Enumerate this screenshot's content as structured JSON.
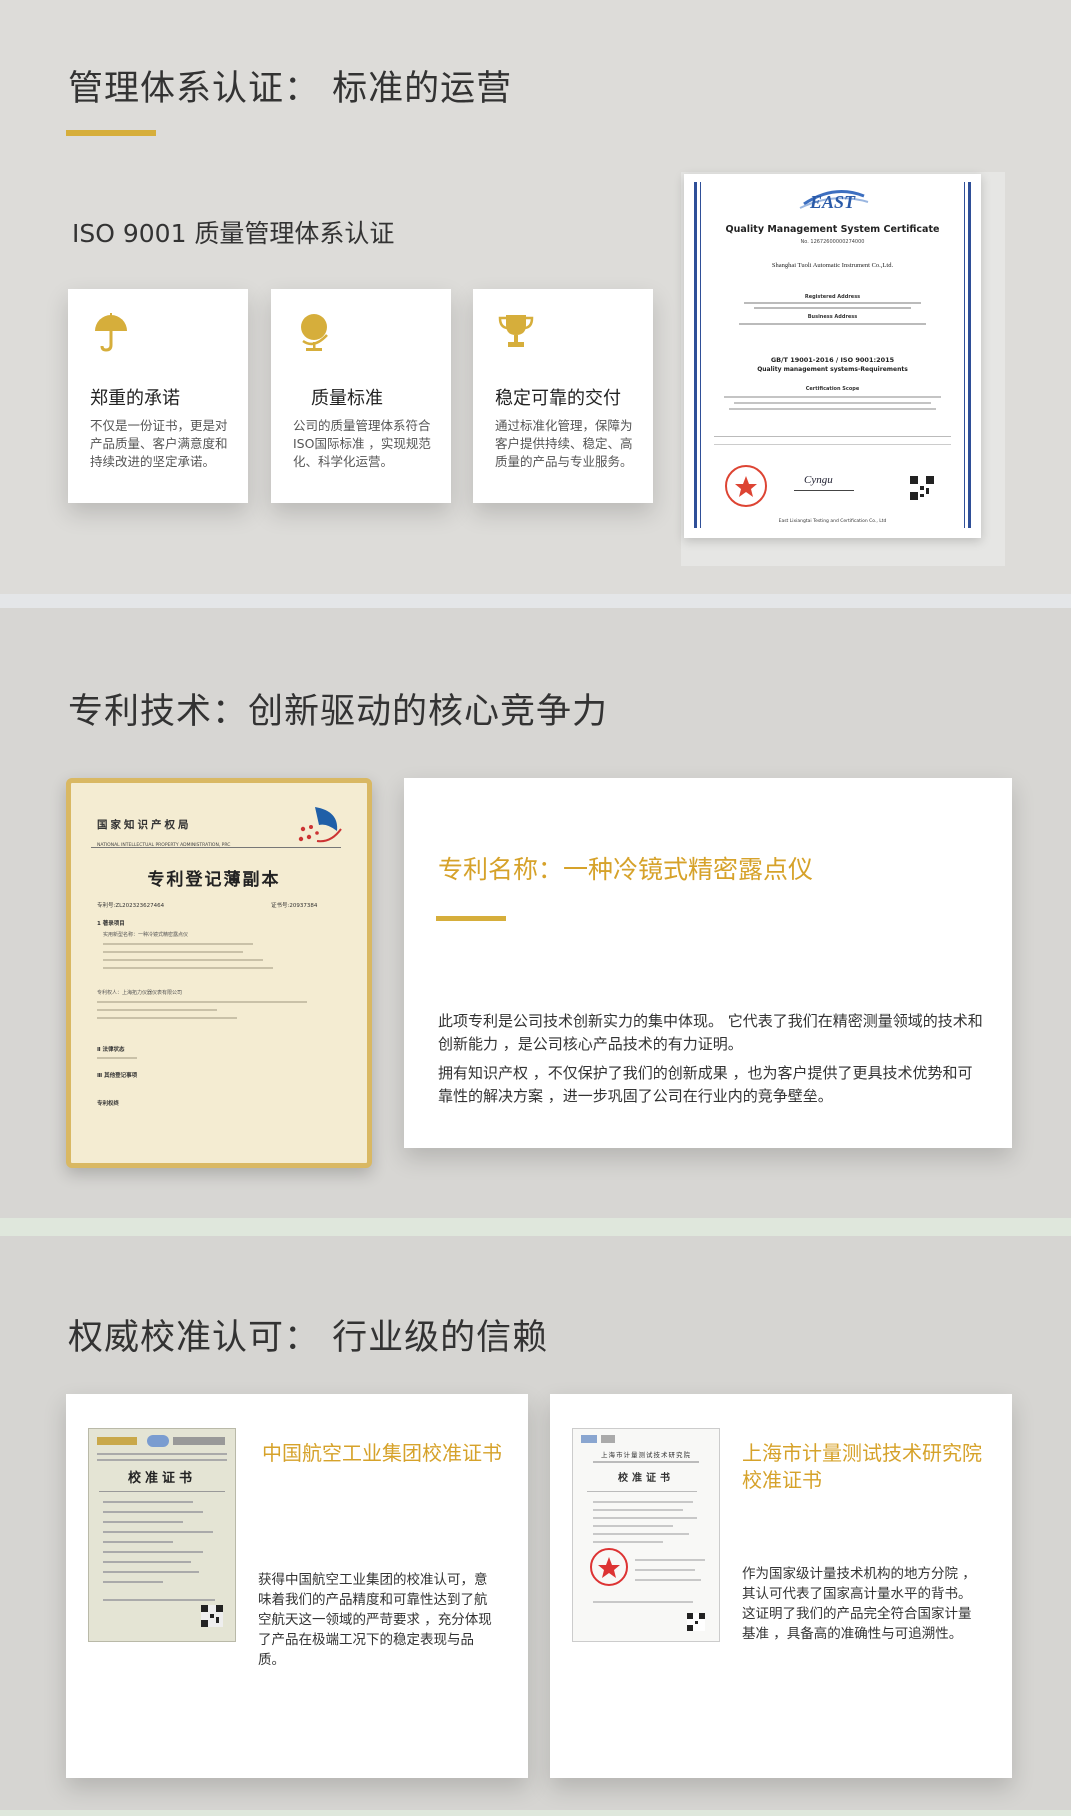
{
  "section1": {
    "title": "管理体系认证： 标准的运营",
    "subtitle": "ISO 9001 质量管理体系认证",
    "cards": [
      {
        "icon": "umbrella-icon",
        "title": "郑重的承诺",
        "desc": "不仅是一份证书，更是对产品质量、客户满意度和持续改进的坚定承诺。"
      },
      {
        "icon": "globe-icon",
        "title": "质量标准",
        "desc": "公司的质量管理体系符合ISO国际标准 ，实现规范化、科学化运营。"
      },
      {
        "icon": "trophy-icon",
        "title": "稳定可靠的交付",
        "desc": "通过标准化管理，保障为客户提供持续、稳定、高质量的产品与专业服务。"
      }
    ],
    "certificate": {
      "logo": "EAST",
      "heading": "Quality Management System Certificate",
      "number": "No. 12672600000274000",
      "company": "Shanghai Tuoli Automatic Instrument Co.,Ltd.",
      "reg_label": "Registered Address",
      "biz_label": "Business Address",
      "standard": "GB/T 19001-2016 / ISO 9001:2015",
      "standard_sub": "Quality management systems-Requirements",
      "scope_label": "Certification Scope",
      "signature": "Cyngu",
      "footer": "East Lixiangtai Testing and Certification Co., Ltd"
    }
  },
  "section2": {
    "title": "专利技术：创新驱动的核心竞争力",
    "doc": {
      "office": "国家知识产权局",
      "office_en": "NATIONAL INTELLECTUAL PROPERTY ADMINISTRATION, PRC",
      "doc_title": "专利登记薄副本",
      "items": [
        "专利号:ZL202323627464",
        "证书号:20937384",
        "1 著录项目",
        "实用新型名称：一种冷镜式精密露点仪",
        "专利权人：上海拓力仪器仪表有限公司",
        "Ⅱ 法律状态",
        "Ⅲ 其他登记事项",
        "专利权终"
      ]
    },
    "patent_label": "专利名称：一种冷镜式精密露点仪",
    "para1": "此项专利是公司技术创新实力的集中体现。 它代表了我们在精密测量领域的技术和创新能力 ，是公司核心产品技术的有力证明。",
    "para2": "拥有知识产权 ，不仅保护了我们的创新成果 ，也为客户提供了更具技术优势和可靠性的解决方案 ，进一步巩固了公司在行业内的竞争壁垒。"
  },
  "section3": {
    "title": "权威校准认可： 行业级的信赖",
    "cards": [
      {
        "title": "中国航空工业集团校准证书",
        "desc": "获得中国航空工业集团的校准认可，意味着我们的产品精度和可靠性达到了航空航天这一领域的严苛要求 ，充分体现了产品在极端工况下的稳定表现与品质。",
        "doc_title": "校准证书"
      },
      {
        "title": "上海市计量测试技术研究院校准证书",
        "desc": "作为国家级计量技术机构的地方分院 ，其认可代表了国家高计量水平的背书。这证明了我们的产品完全符合国家计量基准 ，具备高的准确性与可追溯性。",
        "doc_title": "校准证书",
        "doc_org": "上海市计量测试技术研究院"
      }
    ]
  },
  "colors": {
    "gold": "#d6ae3b",
    "gold_text": "#d6a22a"
  }
}
